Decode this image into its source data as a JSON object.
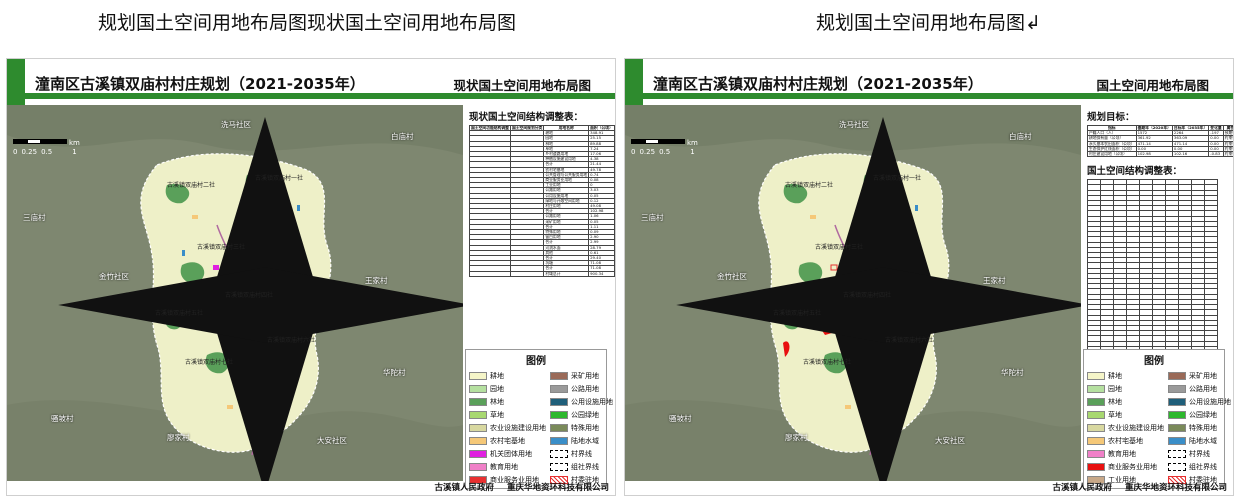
{
  "captions": {
    "left": "规划国土空间用地布局图现状国土空间用地布局图",
    "right": "规划国土空间用地布局图↲"
  },
  "left_panel": {
    "title": "潼南区古溪镇双庙村村庄规划（2021-2035年）",
    "subtitle": "现状国土空间用地布局图",
    "table_title": "现状国土空间结构调整表：",
    "table_header": [
      "国土空间功能结构调整",
      "国土空间规划分类",
      "用地名称",
      "面积（公顷）",
      "比重（%）"
    ],
    "table_rows": [
      [
        "",
        "",
        "耕地",
        "348.91",
        "49.95"
      ],
      [
        "",
        "",
        "园地",
        "25.15",
        "2.84"
      ],
      [
        "",
        "",
        "林地",
        "89.88",
        "9.91"
      ],
      [
        "",
        "",
        "草地",
        "7.24",
        "0.8"
      ],
      [
        "",
        "",
        "乡村道路用地",
        "17.06",
        "1.9"
      ],
      [
        "",
        "",
        "种植设施建设用地",
        "4.38",
        "0.49"
      ],
      [
        "",
        "",
        "合计",
        "21.44",
        "2.39"
      ],
      [
        "",
        "",
        "农村宅基地",
        "49.78",
        "5.53"
      ],
      [
        "",
        "",
        "公共管理与公共服务用地",
        "0.74",
        "0.08"
      ],
      [
        "",
        "",
        "商业服务业用地",
        "0.08",
        "0.01"
      ],
      [
        "",
        "",
        "工业用地",
        "0",
        "0"
      ],
      [
        "",
        "",
        "公路用地",
        "3.03",
        "0.34"
      ],
      [
        "",
        "",
        "公用设施用地",
        "0.05",
        "0.01"
      ],
      [
        "",
        "",
        "绿地与开敞空间用地",
        "0.12",
        "0.01"
      ],
      [
        "",
        "",
        "村庄用地",
        "49.08",
        "5.45"
      ],
      [
        "",
        "",
        "合计",
        "102.98",
        "11.43"
      ],
      [
        "",
        "",
        "公路用地",
        "1.06",
        "0.12"
      ],
      [
        "",
        "",
        "采矿用地",
        "0.05",
        "0.01"
      ],
      [
        "",
        "",
        "合计",
        "1.11",
        "0.12"
      ],
      [
        "",
        "",
        "特殊用地",
        "0.09",
        "0.01"
      ],
      [
        "",
        "",
        "留白用地",
        "2.90",
        "0.32"
      ],
      [
        "",
        "",
        "合计",
        "2.99",
        "0.33"
      ],
      [
        "",
        "",
        "河流水面",
        "28.79",
        "3.2"
      ],
      [
        "",
        "",
        "其他",
        "0.61",
        "0.07"
      ],
      [
        "",
        "",
        "合计",
        "29.40",
        "3.26"
      ],
      [
        "",
        "",
        "坑塘",
        "71.08",
        "7.89"
      ],
      [
        "",
        "",
        "合计",
        "71.08",
        "7.89"
      ],
      [
        "",
        "",
        "村域总计",
        "900.34",
        "100"
      ]
    ],
    "legend_title": "图例",
    "legend": [
      {
        "label": "耕地",
        "color": "#f5f5c8"
      },
      {
        "label": "采矿用地",
        "color": "#9a6a58"
      },
      {
        "label": "园地",
        "color": "#b5e0a0"
      },
      {
        "label": "公路用地",
        "color": "#9a9a9a"
      },
      {
        "label": "林地",
        "color": "#5aa05a"
      },
      {
        "label": "公用设施用地",
        "color": "#1f5f7a"
      },
      {
        "label": "草地",
        "color": "#a8d870"
      },
      {
        "label": "公园绿地",
        "color": "#2db82d"
      },
      {
        "label": "农业设施建设用地",
        "color": "#d8d8a0"
      },
      {
        "label": "特殊用地",
        "color": "#7a8a5a"
      },
      {
        "label": "农村宅基地",
        "color": "#f5c878"
      },
      {
        "label": "陆地水域",
        "color": "#3a8ec8"
      },
      {
        "label": "机关团体用地",
        "color": "#e020e0"
      },
      {
        "label": "村界线",
        "color": "dashed"
      },
      {
        "label": "教育用地",
        "color": "#f080c8"
      },
      {
        "label": "组社界线",
        "color": "dashed"
      },
      {
        "label": "商业服务业用地",
        "color": "#e83030"
      },
      {
        "label": "村委驻地",
        "color": "hatch"
      }
    ],
    "footer": [
      "古溪镇人民政府",
      "重庆华地资环科技有限公司"
    ]
  },
  "right_panel": {
    "title": "潼南区古溪镇双庙村村庄规划（2021-2035年）",
    "subtitle": "国土空间用地布局图",
    "goals_title": "规划目标：",
    "goals_header": [
      "指标",
      "基期年（2020年）",
      "目标年（2035年）",
      "变化量",
      "属性"
    ],
    "goals_rows": [
      [
        "户籍人口（人）",
        "1572",
        "2264",
        "-197",
        "预期性"
      ],
      [
        "耕地保有量（公顷）",
        "361.92",
        "363.09",
        "0.00",
        "约束性"
      ],
      [
        "永久基本农田面积（公顷）",
        "471.14",
        "471.14",
        "0.00",
        "约束性"
      ],
      [
        "生态保护红线面积（公顷）",
        "0.00",
        "0.00",
        "0.00",
        "约束性"
      ],
      [
        "村庄建设用地（公顷）",
        "102.98",
        "102.16",
        "-0.83",
        "约束性"
      ]
    ],
    "table_title": "国土空间结构调整表：",
    "table_rows_count": 40,
    "legend_title": "图例",
    "legend": [
      {
        "label": "耕地",
        "color": "#f5f5c8"
      },
      {
        "label": "采矿用地",
        "color": "#9a6a58"
      },
      {
        "label": "园地",
        "color": "#b5e0a0"
      },
      {
        "label": "公路用地",
        "color": "#9a9a9a"
      },
      {
        "label": "林地",
        "color": "#5aa05a"
      },
      {
        "label": "公用设施用地",
        "color": "#1f5f7a"
      },
      {
        "label": "草地",
        "color": "#a8d870"
      },
      {
        "label": "公园绿地",
        "color": "#2db82d"
      },
      {
        "label": "农业设施建设用地",
        "color": "#d8d8a0"
      },
      {
        "label": "特殊用地",
        "color": "#7a8a5a"
      },
      {
        "label": "农村宅基地",
        "color": "#f5c878"
      },
      {
        "label": "陆地水域",
        "color": "#3a8ec8"
      },
      {
        "label": "教育用地",
        "color": "#f080c8"
      },
      {
        "label": "村界线",
        "color": "dashed"
      },
      {
        "label": "商业服务业用地",
        "color": "#e81010"
      },
      {
        "label": "组社界线",
        "color": "dashed"
      },
      {
        "label": "工业用地",
        "color": "#c8a888"
      },
      {
        "label": "村委驻地",
        "color": "hatch"
      }
    ],
    "footer": [
      "古溪镇人民政府",
      "重庆华地资环科技有限公司"
    ]
  },
  "map_labels": [
    "洗马社区",
    "白庙村",
    "三庙村",
    "金竹社区",
    "王家村",
    "华陀村",
    "骚坡村",
    "廖家村",
    "大安社区"
  ],
  "group_labels": [
    "古溪镇双庙村一社",
    "古溪镇双庙村二社",
    "古溪镇双庙村三社",
    "古溪镇双庙村四社",
    "古溪镇双庙村五社",
    "古溪镇双庙村六社",
    "古溪镇双庙村七社",
    "古溪镇双庙村八社",
    "古溪镇双庙村九社",
    "古溪镇双庙村十社",
    "古溪镇双庙村十一社"
  ],
  "scale": {
    "labels": [
      "0",
      "0.25",
      "0.5",
      "1"
    ],
    "unit": "km"
  }
}
